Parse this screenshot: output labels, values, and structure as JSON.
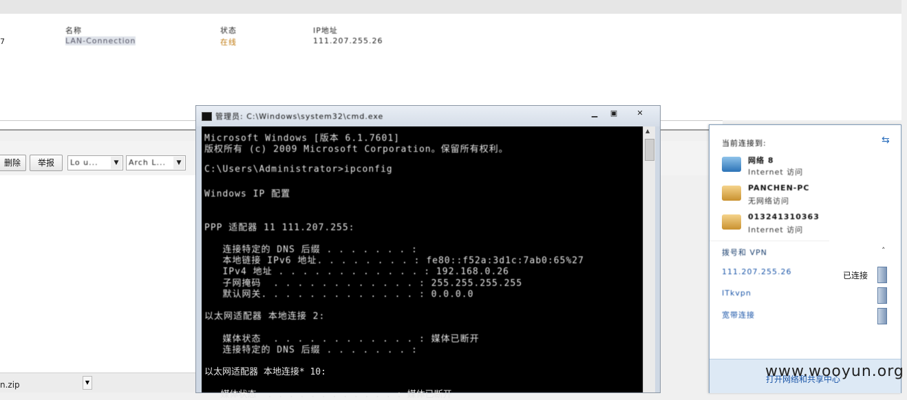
{
  "background": {
    "list_headers": [
      "名称",
      "状态",
      "IP地址"
    ],
    "row_prefix": "7",
    "row_cells": [
      "LAN-Connection",
      "在线",
      "111.207.255.26"
    ],
    "toolbar": {
      "delete_label": "删除",
      "report_label": "举报",
      "select1_value": "Lo u...",
      "select2_value": "Arch L..."
    },
    "bottom_file": "n.zip"
  },
  "cmd": {
    "title": "管理员: C:\\Windows\\system32\\cmd.exe",
    "lines": [
      "Microsoft Windows [版本 6.1.7601]",
      "版权所有 (c) 2009 Microsoft Corporation。保留所有权利。",
      "",
      "C:\\Users\\Administrator>ipconfig",
      "",
      "Windows IP 配置",
      "",
      "",
      "PPP 适配器 11 111.207.255:",
      "",
      "   连接特定的 DNS 后缀 . . . . . . . :",
      "   本地链接 IPv6 地址. . . . . . . . : fe80::f52a:3d1c:7ab0:65%27",
      "   IPv4 地址 . . . . . . . . . . . . : 192.168.0.26",
      "   子网掩码  . . . . . . . . . . . . : 255.255.255.255",
      "   默认网关. . . . . . . . . . . . . : 0.0.0.0",
      "",
      "以太网适配器 本地连接 2:",
      "",
      "   媒体状态  . . . . . . . . . . . . : 媒体已断开",
      "   连接特定的 DNS 后缀 . . . . . . . :",
      "",
      "以太网适配器 本地连接* 10:",
      "",
      "   媒体状态  . . . . . . . . . . . . : 媒体已断开"
    ]
  },
  "network": {
    "header": "当前连接到:",
    "networks": [
      {
        "name": "网络 8",
        "status": "Internet 访问"
      },
      {
        "name": "PANCHEN-PC",
        "status": "无网络访问"
      },
      {
        "name": "013241310363",
        "status": "Internet 访问"
      }
    ],
    "section_label": "拨号和 VPN",
    "connections": [
      {
        "name": "111.207.255.26",
        "status": "已连接"
      },
      {
        "name": "ITkvpn",
        "status": ""
      },
      {
        "name": "宽带连接",
        "status": ""
      }
    ],
    "footer_link": "打开网络和共享中心",
    "refresh_icon": "refresh-icon",
    "collapse_icon": "chevron-up-icon"
  },
  "watermark": "www.wooyun.org"
}
